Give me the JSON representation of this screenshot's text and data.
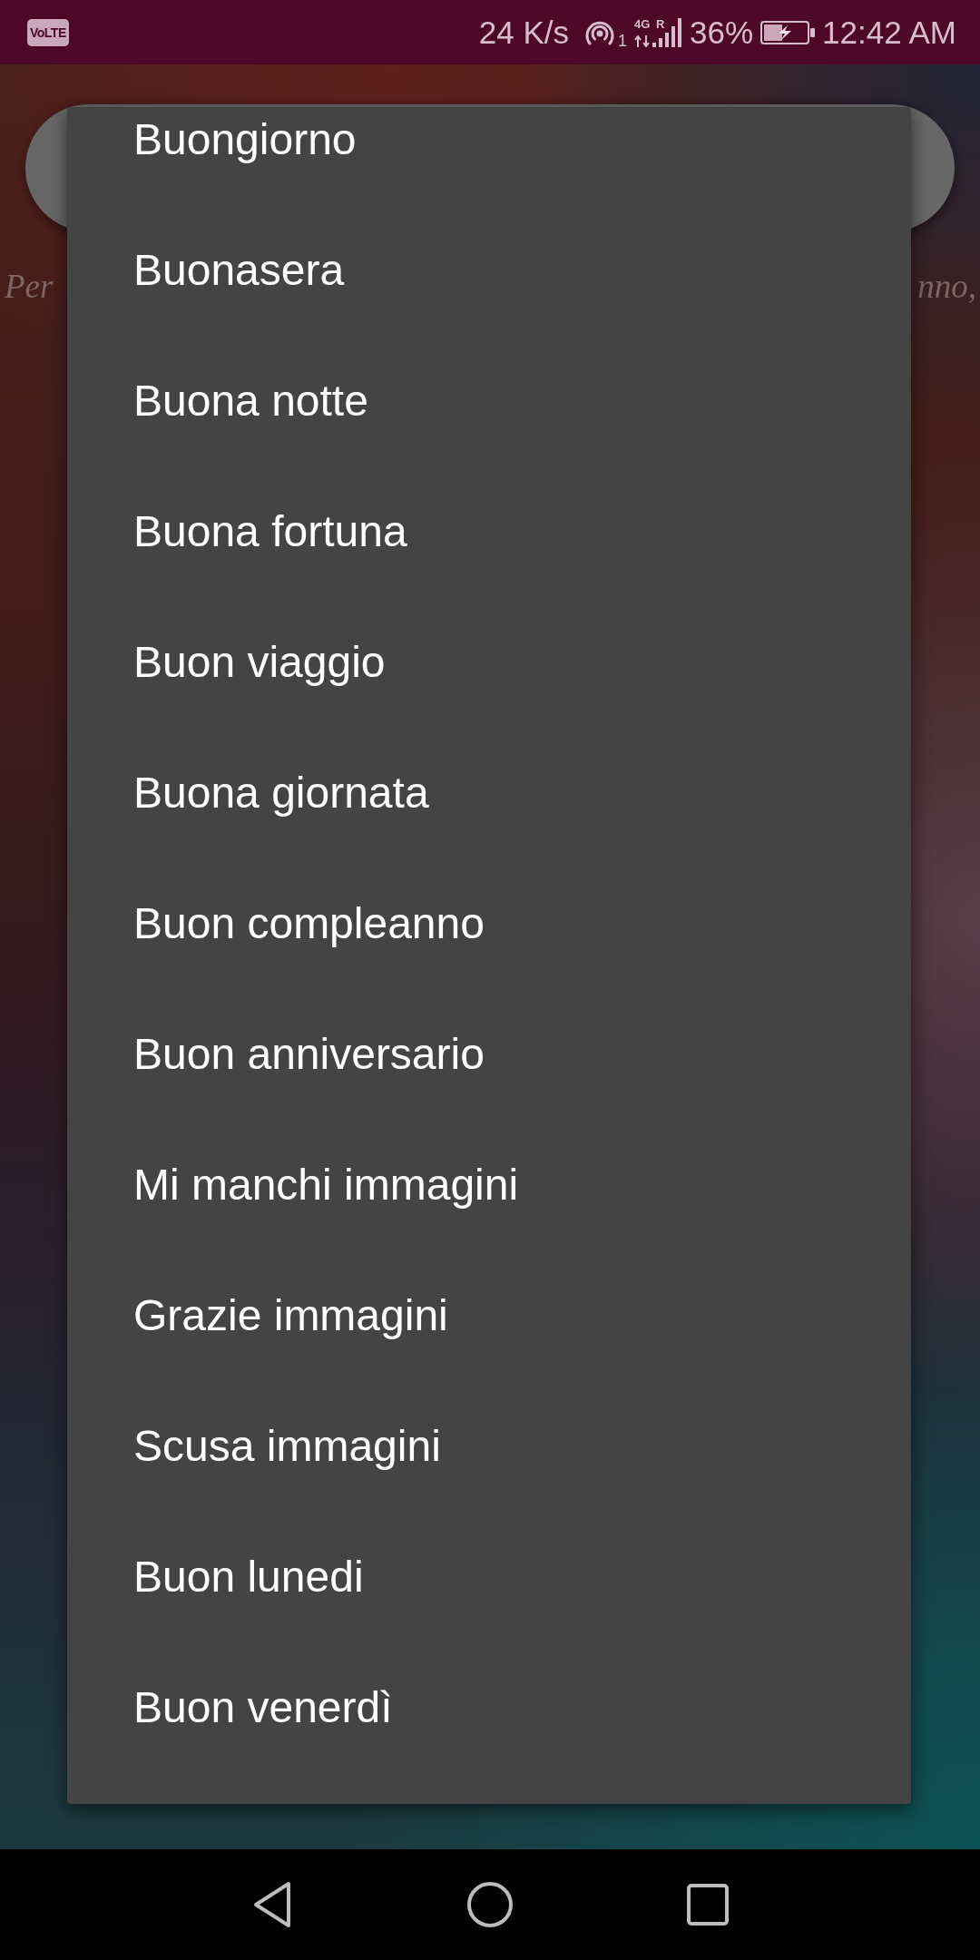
{
  "status_bar": {
    "volte": "VoLTE",
    "speed": "24 K/s",
    "hotspot_badge": "1",
    "network": "4G",
    "roaming": "R",
    "battery": "36%",
    "charging": true,
    "time": "12:42 AM"
  },
  "screen": {
    "description": {
      "visible_start": "Per",
      "visible_end": "nno,"
    }
  },
  "dropdown": {
    "items": [
      {
        "label": "Buongiorno"
      },
      {
        "label": "Buonasera"
      },
      {
        "label": "Buona notte"
      },
      {
        "label": "Buona fortuna"
      },
      {
        "label": "Buon viaggio"
      },
      {
        "label": "Buona giornata"
      },
      {
        "label": "Buon compleanno"
      },
      {
        "label": "Buon anniversario"
      },
      {
        "label": "Mi manchi immagini"
      },
      {
        "label": "Grazie immagini"
      },
      {
        "label": "Scusa immagini"
      },
      {
        "label": "Buon lunedi"
      },
      {
        "label": "Buon venerdì"
      }
    ]
  }
}
